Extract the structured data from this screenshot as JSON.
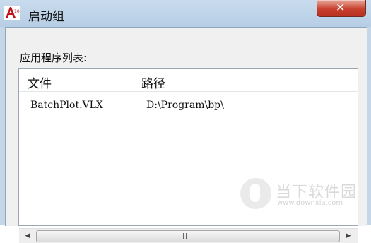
{
  "window": {
    "title": "启动组",
    "icon": "autocad-a10-icon",
    "close_glyph": "✕"
  },
  "list": {
    "caption": "应用程序列表:",
    "columns": [
      "文件",
      "路径"
    ],
    "rows": [
      {
        "file": "BatchPlot.VLX",
        "path": "D:\\Program\\bp\\"
      }
    ]
  },
  "scrollbar": {
    "left_arrow": "◀",
    "right_arrow": "▶",
    "position": 0
  },
  "watermark": {
    "title": "当下软件园",
    "url": "www.downxia.com"
  },
  "colors": {
    "titlebar": "#c4d6e8",
    "close_button": "#c8412f",
    "icon_red": "#c0141c"
  }
}
